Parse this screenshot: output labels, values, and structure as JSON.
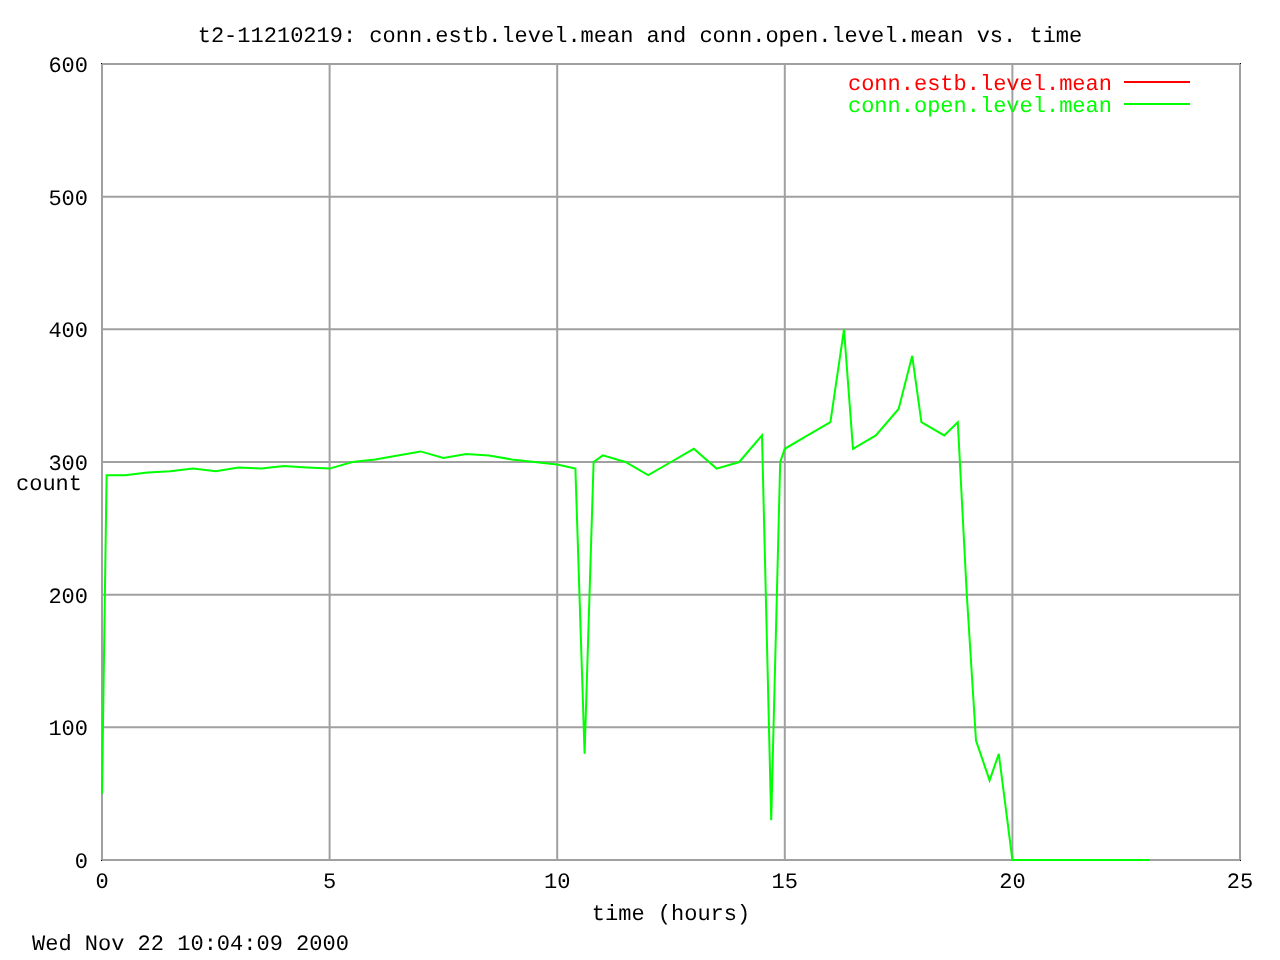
{
  "chart": {
    "chart_data": {
      "type": "line",
      "title": "t2-11210219: conn.estb.level.mean and conn.open.level.mean vs. time",
      "xlabel": "time (hours)",
      "ylabel": "count",
      "xlim": [
        0,
        25
      ],
      "ylim": [
        0,
        600
      ],
      "grid": true,
      "legend": true,
      "xticks": [
        0,
        5,
        10,
        15,
        20,
        25
      ],
      "yticks": [
        0,
        100,
        200,
        300,
        400,
        500,
        600
      ],
      "x": [
        0,
        0.1,
        0.5,
        1,
        1.5,
        2,
        2.5,
        3,
        3.5,
        4,
        4.5,
        5,
        5.5,
        6,
        6.5,
        7,
        7.5,
        8,
        8.5,
        9,
        9.5,
        10,
        10.4,
        10.6,
        10.8,
        11,
        11.5,
        12,
        12.5,
        13,
        13.5,
        14,
        14.5,
        14.7,
        14.9,
        15,
        15.5,
        16,
        16.3,
        16.5,
        17,
        17.5,
        17.8,
        18,
        18.5,
        18.8,
        19,
        19.2,
        19.5,
        19.7,
        20,
        21,
        22,
        23
      ],
      "series": [
        {
          "name": "conn.estb.level.mean",
          "color": "#ff0000",
          "values": [
            null,
            null,
            null,
            null,
            null,
            null,
            null,
            null,
            null,
            null,
            null,
            null,
            null,
            null,
            null,
            null,
            null,
            null,
            null,
            null,
            null,
            null,
            null,
            null,
            null,
            null,
            null,
            null,
            null,
            null,
            null,
            null,
            null,
            null,
            null,
            null,
            null,
            null,
            null,
            null,
            null,
            null,
            null,
            null,
            null,
            null,
            null,
            null,
            null,
            null,
            null,
            null,
            null,
            null
          ]
        },
        {
          "name": "conn.open.level.mean",
          "color": "#00ff00",
          "values": [
            50,
            290,
            290,
            292,
            293,
            295,
            293,
            296,
            295,
            297,
            296,
            295,
            300,
            302,
            305,
            308,
            303,
            306,
            305,
            302,
            300,
            298,
            295,
            80,
            300,
            305,
            300,
            290,
            300,
            310,
            295,
            300,
            320,
            30,
            300,
            310,
            320,
            330,
            400,
            310,
            320,
            340,
            380,
            330,
            320,
            330,
            200,
            90,
            60,
            80,
            0,
            0,
            0,
            0
          ]
        }
      ]
    }
  },
  "timestamp": "Wed Nov 22 10:04:09 2000"
}
